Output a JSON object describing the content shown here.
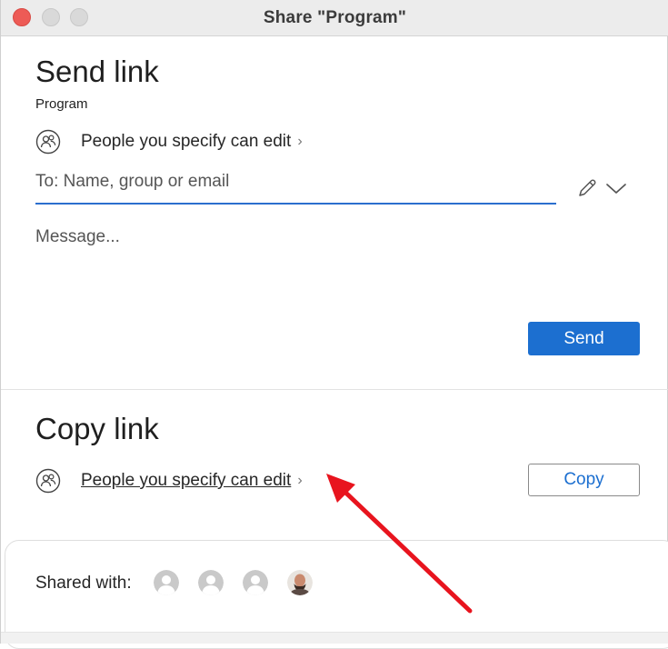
{
  "window": {
    "title": "Share \"Program\""
  },
  "send_link": {
    "heading": "Send link",
    "file_name": "Program",
    "permission": "People you specify can edit",
    "chevron": "›",
    "to_placeholder": "To: Name, group or email",
    "message_placeholder": "Message...",
    "send_label": "Send"
  },
  "copy_link": {
    "heading": "Copy link",
    "permission": "People you specify can edit",
    "chevron": "›",
    "copy_label": "Copy"
  },
  "shared_with": {
    "label": "Shared with:",
    "avatars": [
      {
        "type": "placeholder",
        "icon": "person-icon"
      },
      {
        "type": "placeholder",
        "icon": "person-icon"
      },
      {
        "type": "placeholder",
        "icon": "person-icon"
      },
      {
        "type": "photo",
        "icon": "user-photo"
      }
    ]
  },
  "colors": {
    "accent": "#1c6fd0",
    "annotation_arrow": "#e8141e",
    "close_button": "#ed5b56"
  }
}
